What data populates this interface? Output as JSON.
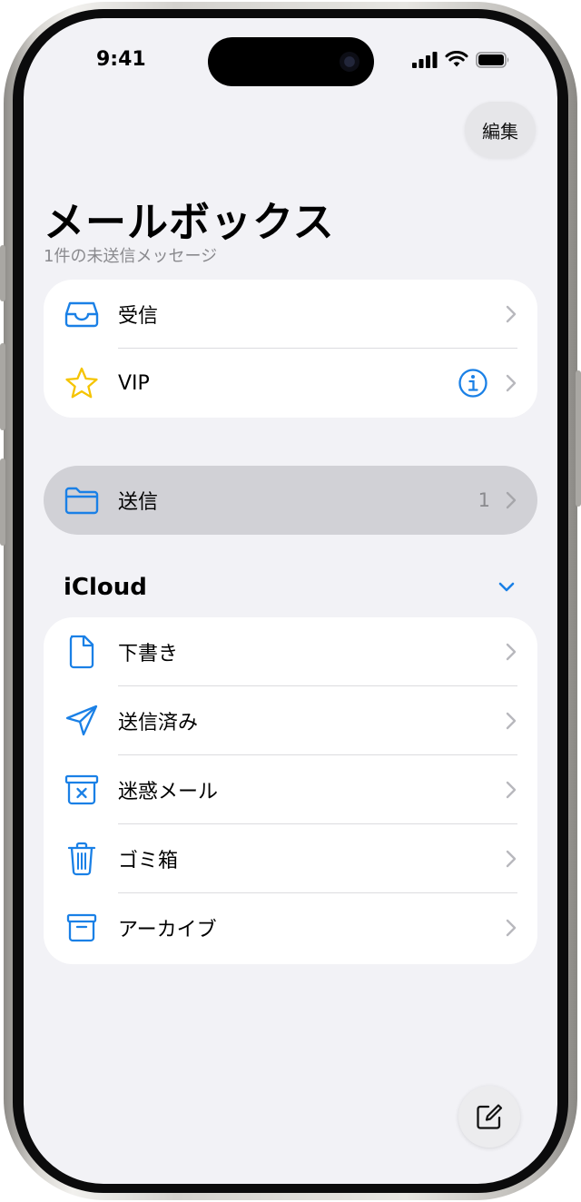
{
  "status_bar": {
    "time": "9:41"
  },
  "toolbar": {
    "edit_label": "編集"
  },
  "header": {
    "title": "メールボックス",
    "subtitle": "1件の未送信メッセージ"
  },
  "top_mailboxes": [
    {
      "label": "受信",
      "icon": "inbox-icon"
    },
    {
      "label": "VIP",
      "icon": "star-icon"
    }
  ],
  "sent_mailbox": {
    "label": "送信",
    "icon": "folder-icon",
    "count": "1"
  },
  "account_section": {
    "title": "iCloud",
    "items": [
      {
        "label": "下書き",
        "icon": "document-icon"
      },
      {
        "label": "送信済み",
        "icon": "paperplane-icon"
      },
      {
        "label": "迷惑メール",
        "icon": "junk-icon"
      },
      {
        "label": "ゴミ箱",
        "icon": "trash-icon"
      },
      {
        "label": "アーカイブ",
        "icon": "archive-icon"
      }
    ]
  },
  "colors": {
    "accent": "#1a80e6",
    "vip_star": "#f5c400",
    "background": "#f2f2f6",
    "selected_row": "#d1d1d6"
  }
}
